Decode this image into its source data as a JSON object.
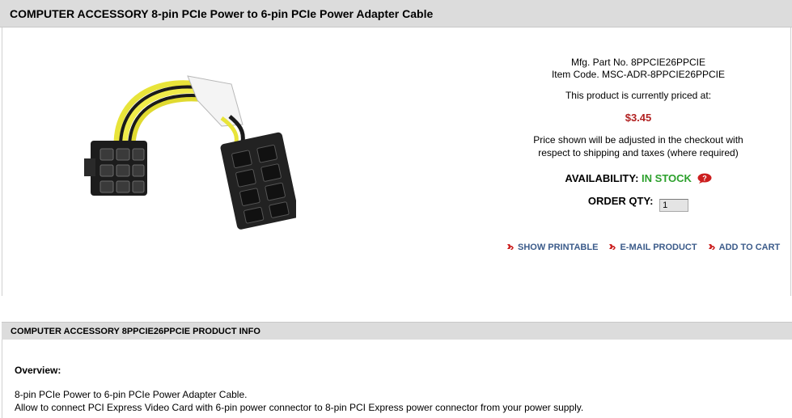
{
  "product": {
    "title": "COMPUTER ACCESSORY 8-pin PCIe Power to 6-pin PCIe Power Adapter Cable",
    "mfg_part": "Mfg. Part No. 8PPCIE26PPCIE",
    "item_code": "Item Code. MSC-ADR-8PPCIE26PPCIE",
    "price_intro": "This product is currently priced at:",
    "price": "$3.45",
    "price_note_line1": "Price shown will be adjusted in the checkout with",
    "price_note_line2": "respect to shipping and taxes (where required)",
    "availability_label": "AVAILABILITY:",
    "availability_value": "IN STOCK",
    "order_qty_label": "ORDER QTY:",
    "order_qty_value": "1",
    "image_icon": "pcie-adapter-cable-photo"
  },
  "actions": {
    "show_printable": "SHOW PRINTABLE",
    "email_product": "E-MAIL PRODUCT",
    "add_to_cart": "ADD TO CART",
    "bullet_icon": "red-diamond-arrow-icon"
  },
  "info": {
    "section_title": "COMPUTER ACCESSORY 8PPCIE26PPCIE PRODUCT INFO",
    "overview_title": "Overview:",
    "overview_line1": "8-pin PCIe Power to 6-pin PCIe Power Adapter Cable.",
    "overview_line2": "Allow to connect PCI Express Video Card with 6-pin power connector to 8-pin PCI Express power connector from your power supply."
  },
  "colors": {
    "header_bg": "#dcdcdc",
    "price": "#b22222",
    "in_stock": "#2ca02c",
    "action_link": "#3b5b8a",
    "bullet": "#cc2222"
  }
}
